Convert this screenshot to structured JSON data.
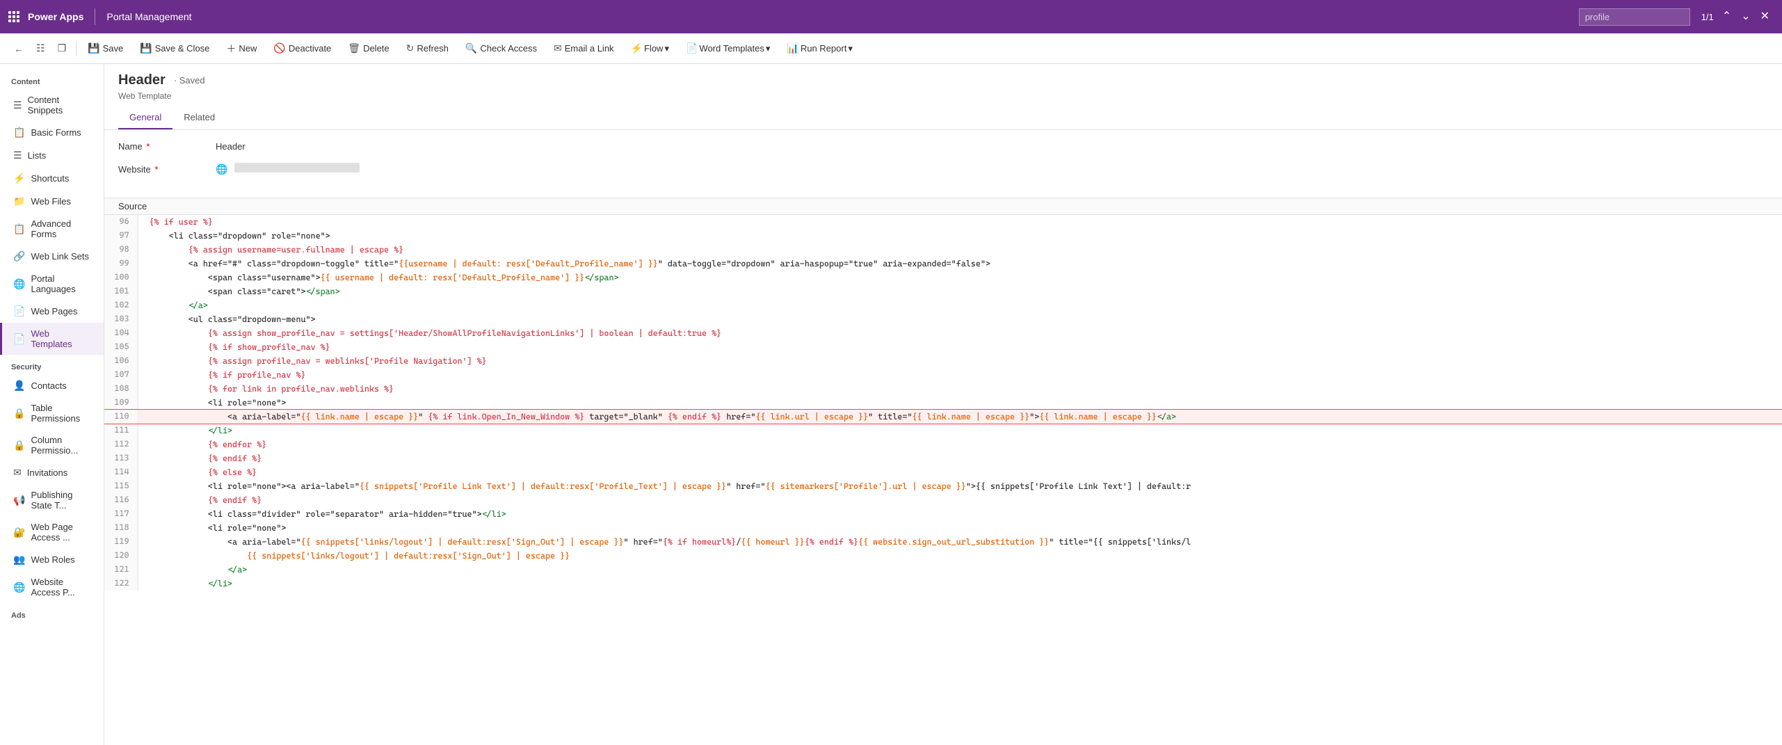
{
  "topbar": {
    "app_name": "Power Apps",
    "portal_name": "Portal Management",
    "search_placeholder": "profile",
    "search_count": "1/1"
  },
  "commandbar": {
    "back": "←",
    "save": "Save",
    "save_close": "Save & Close",
    "new": "New",
    "deactivate": "Deactivate",
    "delete": "Delete",
    "refresh": "Refresh",
    "check_access": "Check Access",
    "email_link": "Email a Link",
    "flow": "Flow",
    "word_templates": "Word Templates",
    "run_report": "Run Report"
  },
  "sidebar": {
    "content_label": "Content",
    "items_content": [
      {
        "id": "content-snippets",
        "label": "Content Snippets"
      },
      {
        "id": "basic-forms",
        "label": "Basic Forms"
      },
      {
        "id": "lists",
        "label": "Lists"
      },
      {
        "id": "shortcuts",
        "label": "Shortcuts"
      },
      {
        "id": "web-files",
        "label": "Web Files"
      },
      {
        "id": "advanced-forms",
        "label": "Advanced Forms"
      },
      {
        "id": "web-link-sets",
        "label": "Web Link Sets"
      },
      {
        "id": "portal-languages",
        "label": "Portal Languages"
      },
      {
        "id": "web-pages",
        "label": "Web Pages"
      },
      {
        "id": "web-templates",
        "label": "Web Templates"
      }
    ],
    "security_label": "Security",
    "items_security": [
      {
        "id": "contacts",
        "label": "Contacts"
      },
      {
        "id": "table-permissions",
        "label": "Table Permissions"
      },
      {
        "id": "column-permissions",
        "label": "Column Permissio..."
      },
      {
        "id": "invitations",
        "label": "Invitations"
      },
      {
        "id": "publishing-state",
        "label": "Publishing State T..."
      },
      {
        "id": "web-page-access",
        "label": "Web Page Access ..."
      },
      {
        "id": "web-roles",
        "label": "Web Roles"
      },
      {
        "id": "website-access",
        "label": "Website Access P..."
      }
    ],
    "ads_label": "Ads"
  },
  "form": {
    "title": "Header",
    "saved_status": "Saved",
    "subtitle": "Web Template",
    "tabs": [
      "General",
      "Related"
    ],
    "active_tab": "General",
    "name_label": "Name",
    "name_value": "Header",
    "website_label": "Website",
    "source_label": "Source"
  },
  "code": {
    "lines": [
      {
        "num": 96,
        "content": "{% if user %}",
        "highlight": false
      },
      {
        "num": 97,
        "content": "    <li class=\"dropdown\" role=\"none\">",
        "highlight": false
      },
      {
        "num": 98,
        "content": "        {% assign username=user.fullname | escape %}",
        "highlight": false
      },
      {
        "num": 99,
        "content": "        <a href=\"#\" class=\"dropdown-toggle\" title=\"{{username | default: resx['Default_Profile_name'] }}\" data-toggle=\"dropdown\" aria-haspopup=\"true\" aria-expanded=\"false\">",
        "highlight": false
      },
      {
        "num": 100,
        "content": "            <span class=\"username\">{{ username | default: resx['Default_Profile_name'] }}</span>",
        "highlight": false
      },
      {
        "num": 101,
        "content": "            <span class=\"caret\"></span>",
        "highlight": false
      },
      {
        "num": 102,
        "content": "        </a>",
        "highlight": false
      },
      {
        "num": 103,
        "content": "        <ul class=\"dropdown-menu\">",
        "highlight": false
      },
      {
        "num": 104,
        "content": "            {% assign show_profile_nav = settings['Header/ShowAllProfileNavigationLinks'] | boolean | default:true %}",
        "highlight": false
      },
      {
        "num": 105,
        "content": "            {% if show_profile_nav %}",
        "highlight": false
      },
      {
        "num": 106,
        "content": "            {% assign profile_nav = weblinks['Profile Navigation'] %}",
        "highlight": false
      },
      {
        "num": 107,
        "content": "            {% if profile_nav %}",
        "highlight": false
      },
      {
        "num": 108,
        "content": "            {% for link in profile_nav.weblinks %}",
        "highlight": false
      },
      {
        "num": 109,
        "content": "            <li role=\"none\">",
        "highlight": false
      },
      {
        "num": 110,
        "content": "                <a aria-label=\"{{ link.name | escape }}\" {% if link.Open_In_New_Window %} target=\"_blank\" {% endif %} href=\"{{ link.url | escape }}\" title=\"{{ link.name | escape }}\">{{ link.name | escape }}</a>",
        "highlight": true
      },
      {
        "num": 111,
        "content": "            </li>",
        "highlight": false
      },
      {
        "num": 112,
        "content": "            {% endfor %}",
        "highlight": false
      },
      {
        "num": 113,
        "content": "            {% endif %}",
        "highlight": false
      },
      {
        "num": 114,
        "content": "            {% else %}",
        "highlight": false
      },
      {
        "num": 115,
        "content": "            <li role=\"none\"><a aria-label=\"{{ snippets['Profile Link Text'] | default:resx['Profile_Text'] | escape }}\" href=\"{{ sitemarkers['Profile'].url | escape }}\">{{ snippets['Profile Link Text'] | default:r",
        "highlight": false
      },
      {
        "num": 116,
        "content": "            {% endif %}",
        "highlight": false
      },
      {
        "num": 117,
        "content": "            <li class=\"divider\" role=\"separator\" aria-hidden=\"true\"></li>",
        "highlight": false
      },
      {
        "num": 118,
        "content": "            <li role=\"none\">",
        "highlight": false
      },
      {
        "num": 119,
        "content": "                <a aria-label=\"{{ snippets['links/logout'] | default:resx['Sign_Out'] | escape }}\" href=\"{% if homeurl%}/{{ homeurl }}{% endif %}{{ website.sign_out_url_substitution }}\" title=\"{{ snippets['links/l",
        "highlight": false
      },
      {
        "num": 120,
        "content": "                    {{ snippets['links/logout'] | default:resx['Sign_Out'] | escape }}",
        "highlight": false
      },
      {
        "num": 121,
        "content": "                </a>",
        "highlight": false
      },
      {
        "num": 122,
        "content": "            </li>",
        "highlight": false
      }
    ]
  }
}
